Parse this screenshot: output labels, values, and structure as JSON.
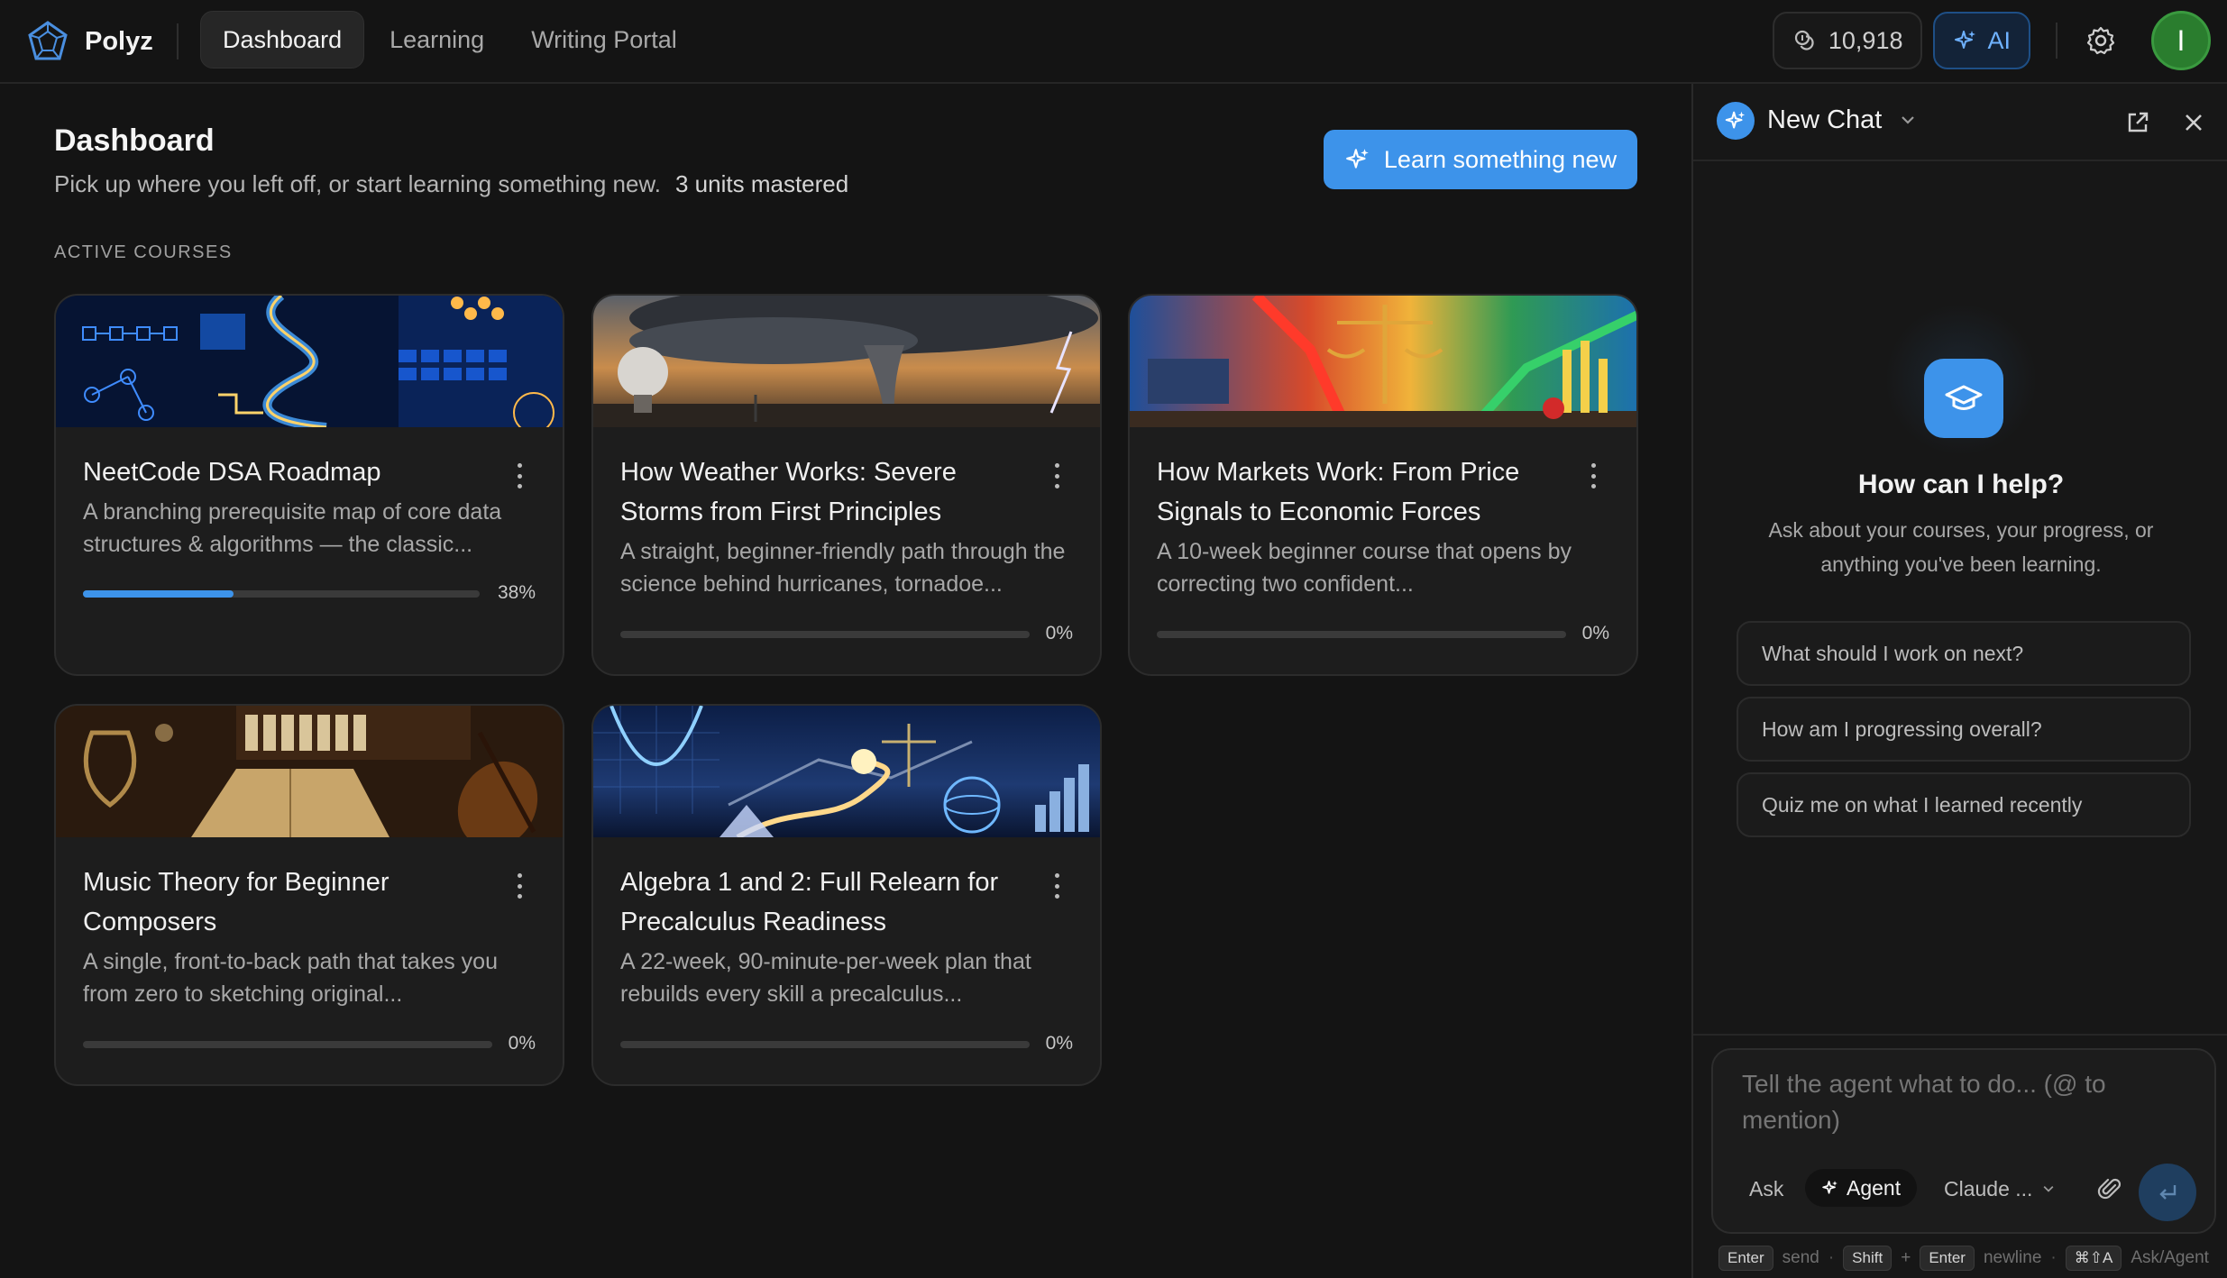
{
  "app": {
    "name": "Polyz"
  },
  "nav": {
    "tabs": [
      {
        "label": "Dashboard",
        "active": true
      },
      {
        "label": "Learning",
        "active": false
      },
      {
        "label": "Writing Portal",
        "active": false
      }
    ]
  },
  "toolbar": {
    "credits": "10,918",
    "ai_label": "AI",
    "avatar_initial": "I",
    "avatar_color": "#2a7d2e"
  },
  "dashboard": {
    "title": "Dashboard",
    "subtitle": "Pick up where you left off, or start learning something new.",
    "mastered": "3 units mastered",
    "cta": "Learn something new",
    "section_label": "ACTIVE COURSES",
    "courses": [
      {
        "title": "NeetCode DSA Roadmap",
        "description": "A branching prerequisite map of core data structures & algorithms — the classic...",
        "progress": 38,
        "progress_label": "38%"
      },
      {
        "title": "How Weather Works: Severe Storms from First Principles",
        "description": "A straight, beginner-friendly path through the science behind hurricanes, tornadoe...",
        "progress": 0,
        "progress_label": "0%"
      },
      {
        "title": "How Markets Work: From Price Signals to Economic Forces",
        "description": "A 10-week beginner course that opens by correcting two confident...",
        "progress": 0,
        "progress_label": "0%"
      },
      {
        "title": "Music Theory for Beginner Composers",
        "description": "A single, front-to-back path that takes you from zero to sketching original...",
        "progress": 0,
        "progress_label": "0%"
      },
      {
        "title": "Algebra 1 and 2: Full Relearn for Precalculus Readiness",
        "description": "A 22-week, 90-minute-per-week plan that rebuilds every skill a precalculus...",
        "progress": 0,
        "progress_label": "0%"
      }
    ]
  },
  "chat": {
    "title": "New Chat",
    "help_title": "How can I help?",
    "help_subtitle": "Ask about your courses, your progress, or anything you've been learning.",
    "suggestions": [
      "What should I work on next?",
      "How am I progressing overall?",
      "Quiz me on what I learned recently"
    ],
    "input_placeholder": "Tell the agent what to do... (@ to mention)",
    "modes": {
      "ask": "Ask",
      "agent": "Agent"
    },
    "model": "Claude ...",
    "hints": {
      "enter": "Enter",
      "send": "send",
      "shift": "Shift",
      "plus": "+",
      "enter2": "Enter",
      "newline": "newline",
      "shortcut": "⌘⇧A",
      "askagent": "Ask/Agent"
    }
  },
  "colors": {
    "accent": "#3d93ea",
    "background": "#141414",
    "card": "#1d1d1d"
  }
}
